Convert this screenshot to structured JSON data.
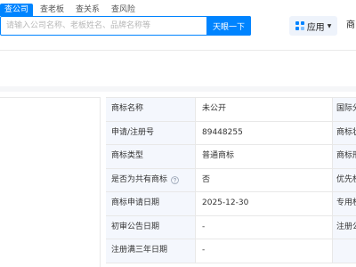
{
  "header": {
    "search_tabs": [
      "查公司",
      "查老板",
      "查关系",
      "查风险"
    ],
    "active_tab_index": 0,
    "search": {
      "placeholder": "请输入公司名称、老板姓名、品牌名称等",
      "button_label": "天眼一下"
    },
    "app_button_label": "应用",
    "right_cutoff_label": "商"
  },
  "info_rows": [
    {
      "label": "商标名称",
      "value": "未公开",
      "right_label": "国际分类"
    },
    {
      "label": "申请/注册号",
      "value": "89448255",
      "right_label": "商标状态"
    },
    {
      "label": "商标类型",
      "value": "普通商标",
      "right_label": "商标形式"
    },
    {
      "label": "是否为共有商标",
      "value": "否",
      "right_label": "优先权",
      "help_icon": true
    },
    {
      "label": "商标申请日期",
      "value": "2025-12-30",
      "right_label": "专用权期限"
    },
    {
      "label": "初审公告日期",
      "value": "-",
      "right_label": "注册公告"
    },
    {
      "label": "注册满三年日期",
      "value": "-",
      "right_label": ""
    }
  ],
  "colors": {
    "accent": "#0084ff",
    "label_bg": "#f4f7fd",
    "border": "#e8e8e8"
  },
  "icons": {
    "app": "grid-icon",
    "app_caret": "caret-down-icon",
    "help": "question-circle-icon"
  }
}
